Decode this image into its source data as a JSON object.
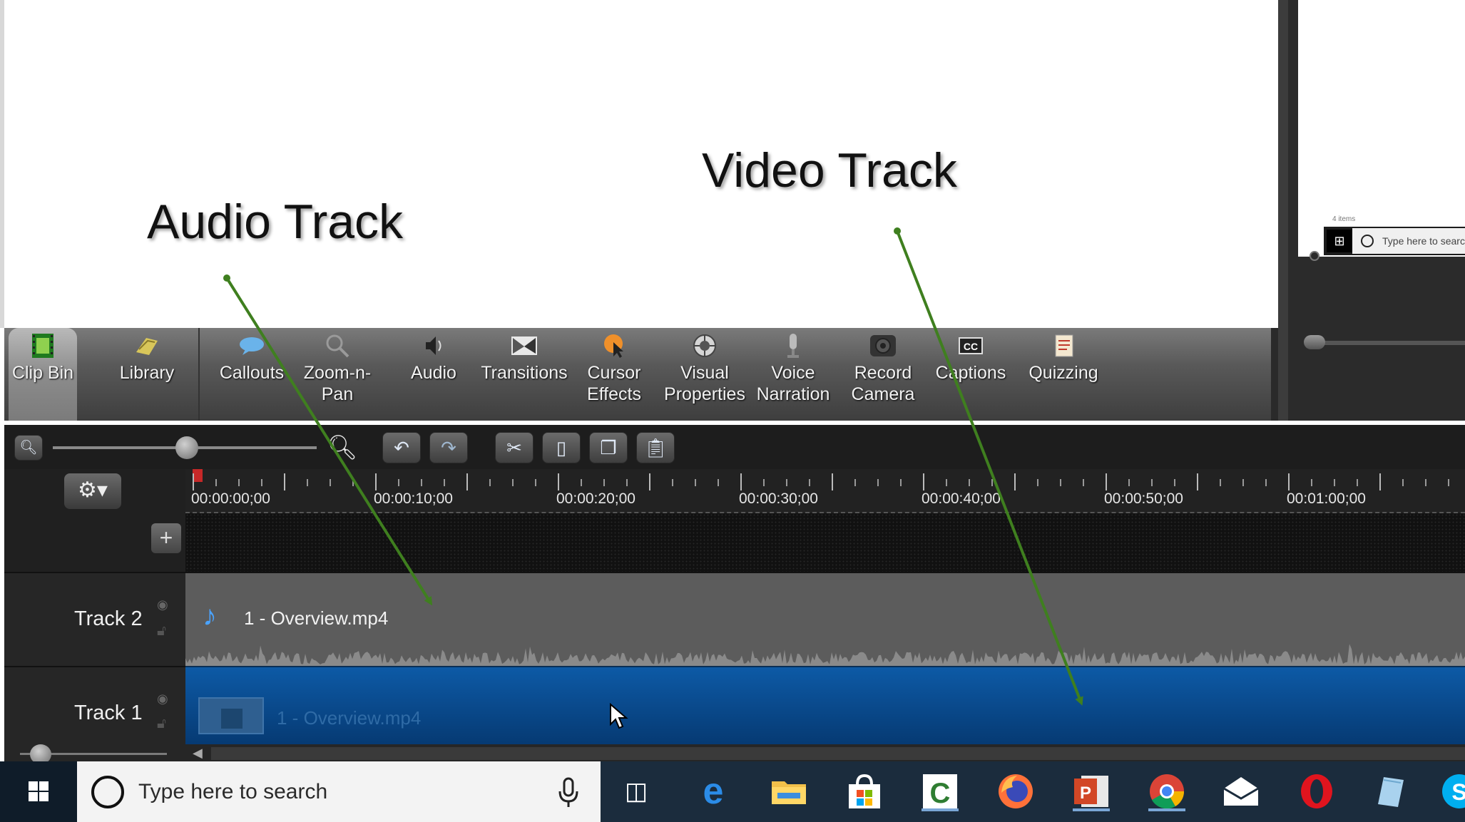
{
  "annotations": {
    "audio_label": "Audio Track",
    "video_label": "Video Track"
  },
  "preview": {
    "mini_items_text": "4 items",
    "mini_search_text": "Type here to search"
  },
  "tabs": [
    {
      "label": "Clip Bin",
      "icon": "film-strip-icon",
      "active": true
    },
    {
      "label": "Library",
      "icon": "library-icon",
      "active": false
    },
    {
      "label": "Callouts",
      "icon": "speech-bubble-icon",
      "active": false
    },
    {
      "label": "Zoom-n-\nPan",
      "icon": "magnifier-icon",
      "active": false
    },
    {
      "label": "Audio",
      "icon": "speaker-icon",
      "active": false
    },
    {
      "label": "Transitions",
      "icon": "transitions-icon",
      "active": false
    },
    {
      "label": "Cursor\nEffects",
      "icon": "cursor-icon",
      "active": false
    },
    {
      "label": "Visual\nProperties",
      "icon": "visual-properties-icon",
      "active": false
    },
    {
      "label": "Voice\nNarration",
      "icon": "microphone-icon",
      "active": false
    },
    {
      "label": "Record\nCamera",
      "icon": "camera-icon",
      "active": false
    },
    {
      "label": "Captions",
      "icon": "cc-icon",
      "active": false
    },
    {
      "label": "Quizzing",
      "icon": "quiz-icon",
      "active": false
    }
  ],
  "timeline": {
    "ruler_labels": [
      "00:00:00;00",
      "00:00:10;00",
      "00:00:20;00",
      "00:00:30;00",
      "00:00:40;00",
      "00:00:50;00",
      "00:01:00;00"
    ],
    "tracks": [
      {
        "name": "Track 2",
        "clip_label": "1 - Overview.mp4",
        "type": "audio"
      },
      {
        "name": "Track 1",
        "clip_label": "1 - Overview.mp4",
        "type": "video"
      }
    ]
  },
  "taskbar": {
    "search_placeholder": "Type here to search",
    "apps": [
      "task-view-icon",
      "edge-icon",
      "file-explorer-icon",
      "store-icon",
      "camtasia-icon",
      "firefox-icon",
      "powerpoint-icon",
      "chrome-icon",
      "mail-icon",
      "opera-icon",
      "notes-icon",
      "skype-icon"
    ]
  },
  "colors": {
    "annotation_arrow": "#3f7f1f",
    "video_track": "#0d5aa6",
    "audio_track": "#5c5c5c",
    "playhead": "#c62828"
  }
}
